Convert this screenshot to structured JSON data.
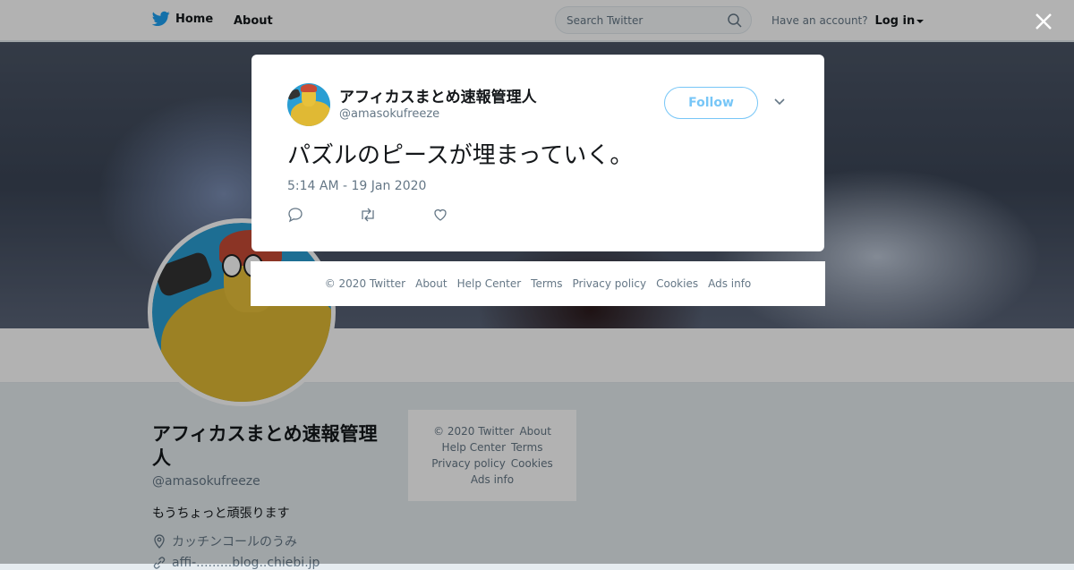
{
  "topbar": {
    "home_label": "Home",
    "about_label": "About",
    "search_placeholder": "Search Twitter",
    "have_account": "Have an account?",
    "login_label": "Log in"
  },
  "profile": {
    "name": "アフィカスまとめ速報管理人",
    "handle": "@amasokufreeze",
    "bio": "もうちょっと頑張ります",
    "location": "カッチンコールのうみ",
    "link": "affi-.........blog..chiebi.jp"
  },
  "side_footer": {
    "row1": [
      "© 2020 Twitter",
      "About"
    ],
    "row2": [
      "Help Center",
      "Terms"
    ],
    "row3": [
      "Privacy policy",
      "Cookies"
    ],
    "row4": [
      "Ads info"
    ]
  },
  "tweet": {
    "author_name": "アフィカスまとめ速報管理人",
    "author_handle": "@amasokufreeze",
    "follow_label": "Follow",
    "text": "パズルのピースが埋まっていく。",
    "timestamp": "5:14 AM - 19 Jan 2020"
  },
  "footer": {
    "links": [
      "© 2020 Twitter",
      "About",
      "Help Center",
      "Terms",
      "Privacy policy",
      "Cookies",
      "Ads info"
    ]
  },
  "colors": {
    "brand_blue": "#1da1f2",
    "text_dark": "#14171a",
    "text_muted": "#657786",
    "background": "#e6ecf0"
  },
  "icons": {
    "logo": "twitter-bird-icon",
    "search": "search-icon",
    "close": "close-icon",
    "chevron": "chevron-down-icon",
    "reply": "reply-icon",
    "retweet": "retweet-icon",
    "like": "heart-icon",
    "location": "location-pin-icon",
    "link": "link-icon"
  }
}
